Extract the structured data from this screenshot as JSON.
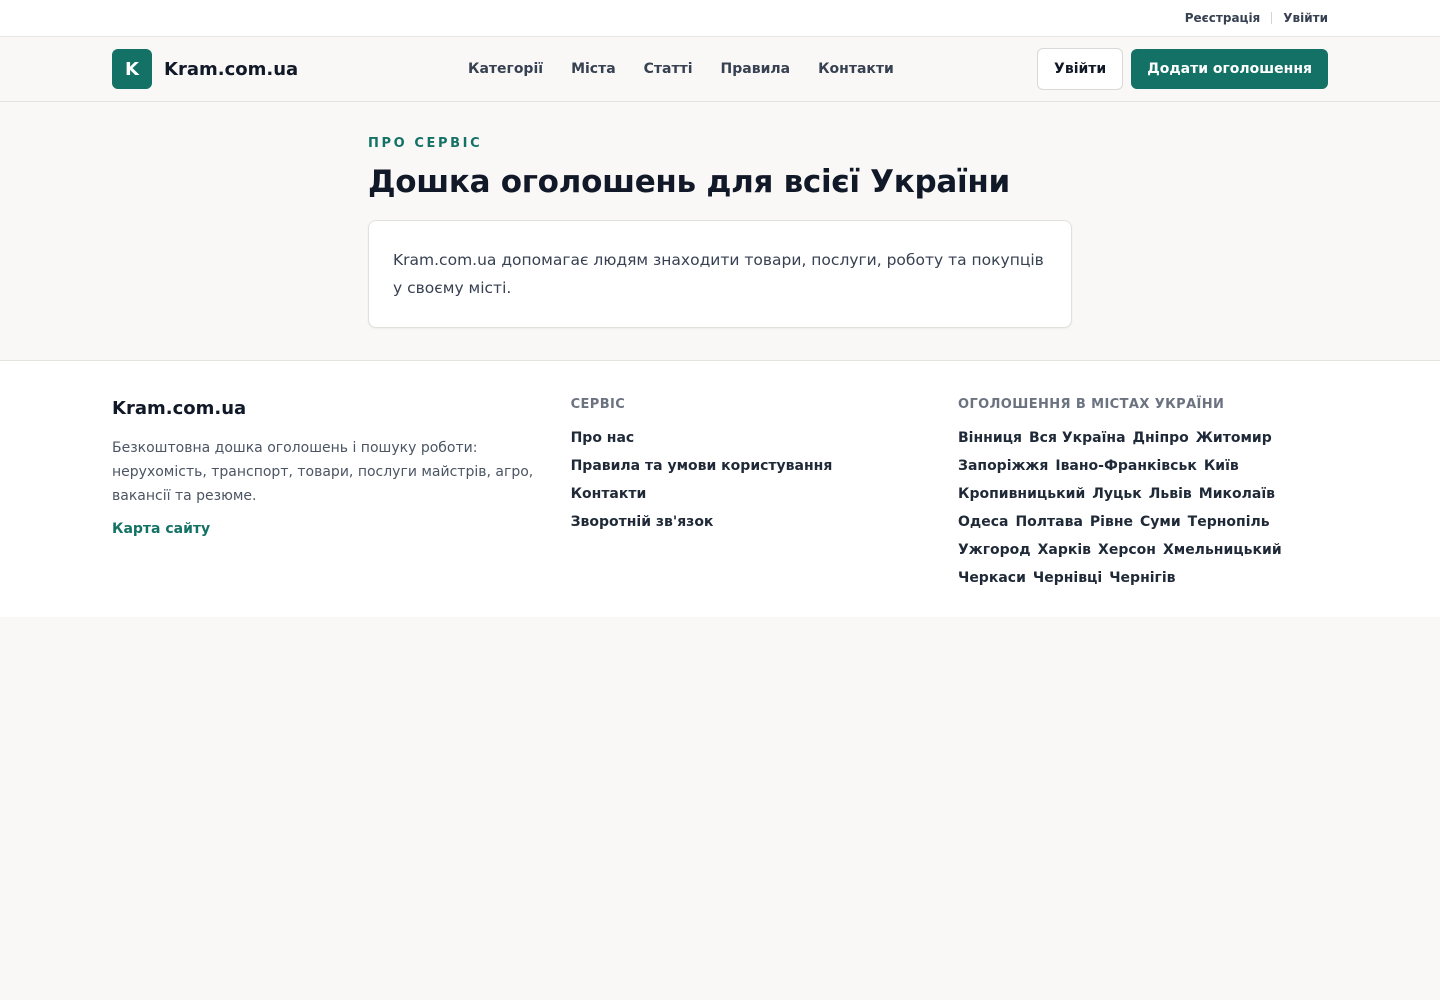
{
  "topbar": {
    "register": "Реєстрація",
    "login": "Увійти"
  },
  "header": {
    "logo_letter": "K",
    "logo_text": "Kram.com.ua",
    "nav": [
      {
        "label": "Категорії"
      },
      {
        "label": "Міста"
      },
      {
        "label": "Статті"
      },
      {
        "label": "Правила"
      },
      {
        "label": "Контакти"
      }
    ],
    "login_button": "Увійти",
    "add_button": "Додати оголошення"
  },
  "main": {
    "eyebrow": "ПРО СЕРВІС",
    "title": "Дошка оголошень для всієї України",
    "card_text": "Kram.com.ua допомагає людям знаходити товари, послуги, роботу та покупців у своєму місті."
  },
  "footer": {
    "brand": "Kram.com.ua",
    "description": "Безкоштовна дошка оголошень і пошуку роботи: нерухомість, транспорт, товари, послуги майстрів, агро, вакансії та резюме.",
    "sitemap": "Карта сайту",
    "service_heading": "СЕРВІС",
    "service_links": [
      {
        "label": "Про нас"
      },
      {
        "label": "Правила та умови користування"
      },
      {
        "label": "Контакти"
      },
      {
        "label": "Зворотній зв'язок"
      }
    ],
    "cities_heading": "ОГОЛОШЕННЯ В МІСТАХ УКРАЇНИ",
    "cities": [
      "Вінниця",
      "Вся Україна",
      "Дніпро",
      "Житомир",
      "Запоріжжя",
      "Івано-Франківськ",
      "Київ",
      "Кропивницький",
      "Луцьк",
      "Львів",
      "Миколаїв",
      "Одеса",
      "Полтава",
      "Рівне",
      "Суми",
      "Тернопіль",
      "Ужгород",
      "Харків",
      "Херсон",
      "Хмельницький",
      "Черкаси",
      "Чернівці",
      "Чернігів"
    ]
  },
  "colors": {
    "brand": "#137265",
    "text": "#111827",
    "background": "#f9f8f6"
  }
}
